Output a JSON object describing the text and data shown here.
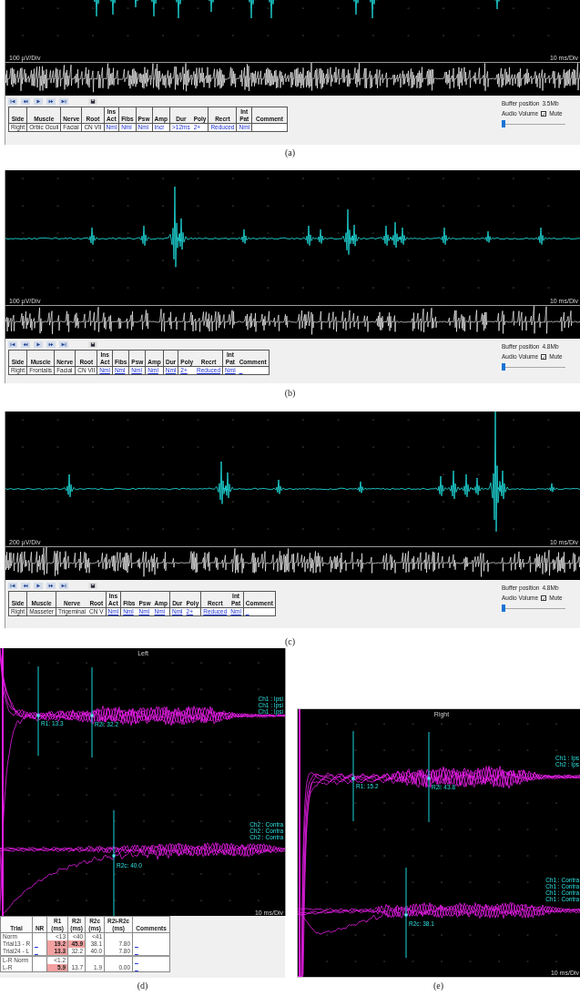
{
  "emg_panels": [
    {
      "amplitude_scale": "100 µV/Div",
      "time_scale": "10 ms/Div",
      "table": {
        "underline_links": false,
        "groups": [
          {
            "columns": [
              {
                "header": "Side",
                "value": "Right",
                "kind": "text"
              }
            ]
          },
          {
            "columns": [
              {
                "header": "Muscle",
                "value": "Orbic Oculi",
                "kind": "text"
              }
            ]
          },
          {
            "columns": [
              {
                "header": "Nerve",
                "value": "Facial",
                "kind": "text"
              }
            ]
          },
          {
            "columns": [
              {
                "header": "Root",
                "value": "CN VII",
                "kind": "text"
              }
            ]
          },
          {
            "columns": [
              {
                "header": "Ins Act",
                "value": "Nml",
                "kind": "link"
              }
            ]
          },
          {
            "columns": [
              {
                "header": "Fibs",
                "value": "Nml",
                "kind": "link"
              }
            ]
          },
          {
            "columns": [
              {
                "header": "Psw",
                "value": "Nml",
                "kind": "link"
              }
            ]
          },
          {
            "columns": [
              {
                "header": "Amp",
                "value": "Incr",
                "kind": "link"
              }
            ]
          },
          {
            "columns": [
              {
                "header": "Dur",
                "value": ">12ms",
                "kind": "link"
              },
              {
                "header": "Poly",
                "value": "2+",
                "kind": "link"
              }
            ]
          },
          {
            "columns": [
              {
                "header": "Recrt",
                "value": "Reduced",
                "kind": "link"
              }
            ]
          },
          {
            "columns": [
              {
                "header": "Int Pat",
                "value": "Nml",
                "kind": "link"
              }
            ]
          },
          {
            "columns": [
              {
                "header": "Comment",
                "kind": "link"
              }
            ]
          }
        ]
      },
      "buffer": {
        "label": "Buffer position",
        "value": "3.5Mb"
      },
      "audio": {
        "label": "Audio Volume",
        "mute": {
          "label": "Mute",
          "checked": true
        },
        "level": 0
      },
      "caption": "(a)"
    },
    {
      "amplitude_scale": "100 µV/Div",
      "time_scale": "10 ms/Div",
      "table": {
        "underline_links": true,
        "groups": [
          {
            "columns": [
              {
                "header": "Side",
                "value": "Right",
                "kind": "text"
              }
            ]
          },
          {
            "columns": [
              {
                "header": "Muscle",
                "value": "Frontalis",
                "kind": "text"
              }
            ]
          },
          {
            "columns": [
              {
                "header": "Nerve",
                "value": "Facial",
                "kind": "text"
              }
            ]
          },
          {
            "columns": [
              {
                "header": "Root",
                "value": "CN VII",
                "kind": "text"
              }
            ]
          },
          {
            "columns": [
              {
                "header": "Ins Act",
                "value": "Nml",
                "kind": "link"
              }
            ]
          },
          {
            "columns": [
              {
                "header": "Fibs",
                "value": "Nml",
                "kind": "link"
              }
            ]
          },
          {
            "columns": [
              {
                "header": "Psw",
                "value": "Nml",
                "kind": "link"
              }
            ]
          },
          {
            "columns": [
              {
                "header": "Amp",
                "value": "Nml",
                "kind": "link"
              }
            ]
          },
          {
            "columns": [
              {
                "header": "Dur",
                "value": "Nml",
                "kind": "link"
              }
            ]
          },
          {
            "columns": [
              {
                "header": "Poly",
                "value": "2+",
                "kind": "link"
              },
              {
                "header": "Recrt",
                "value": "Reduced",
                "kind": "link"
              }
            ]
          },
          {
            "columns": [
              {
                "header": "Int Pat",
                "value": "Nml",
                "kind": "link"
              },
              {
                "header": "Comment",
                "value": "_",
                "kind": "link"
              }
            ]
          }
        ]
      },
      "buffer": {
        "label": "Buffer position",
        "value": "4.8Mb"
      },
      "audio": {
        "label": "Audio Volume",
        "mute": {
          "label": "Mute",
          "checked": true
        },
        "level": 0
      },
      "caption": "(b)"
    },
    {
      "amplitude_scale": "200 µV/Div",
      "time_scale": "10 ms/Div",
      "table": {
        "underline_links": true,
        "groups": [
          {
            "columns": [
              {
                "header": "Side",
                "value": "Right",
                "kind": "text"
              }
            ]
          },
          {
            "columns": [
              {
                "header": "Muscle",
                "value": "Masseter",
                "kind": "text"
              }
            ]
          },
          {
            "columns": [
              {
                "header": "Nerve",
                "value": "Trigeminal",
                "kind": "text"
              },
              {
                "header": "Root",
                "value": "CN V",
                "kind": "text"
              }
            ]
          },
          {
            "columns": [
              {
                "header": "Ins Act",
                "value": "Nml",
                "kind": "link"
              }
            ]
          },
          {
            "columns": [
              {
                "header": "Fibs",
                "value": "Nml",
                "kind": "link"
              },
              {
                "header": "Psw",
                "value": "Nml",
                "kind": "link"
              },
              {
                "header": "Amp",
                "value": "Nml",
                "kind": "link"
              }
            ]
          },
          {
            "columns": [
              {
                "header": "Dur",
                "value": "Nml",
                "kind": "link"
              },
              {
                "header": "Poly",
                "value": "2+",
                "kind": "link"
              }
            ]
          },
          {
            "columns": [
              {
                "header": "Recrt",
                "value": "Reduced",
                "kind": "link"
              },
              {
                "header": "Int Pat",
                "value": "Nml",
                "kind": "link"
              }
            ]
          },
          {
            "columns": [
              {
                "header": "Comment",
                "value": "_",
                "kind": "link"
              }
            ]
          }
        ]
      },
      "buffer": {
        "label": "Buffer position",
        "value": "4.8Mb"
      },
      "audio": {
        "label": "Audio Volume",
        "mute": {
          "label": "Mute",
          "checked": true
        },
        "level": 0
      },
      "caption": "(c)"
    }
  ],
  "reflex_panels": [
    {
      "title": "Left",
      "cursors": [
        "R1: 13.3",
        "R2i: 32.2",
        "R2c: 40.0"
      ],
      "upper_channel_labels": [
        "Ch1 : Ipsi",
        "Ch1 : Ipsi",
        "Ch1 : Ipsi"
      ],
      "lower_channel_labels": [
        "Ch2 : Contra",
        "Ch2 : Contra",
        "Ch2 : Contra"
      ],
      "time_scale": "10 ms/Div",
      "table": {
        "columns": [
          {
            "label": "Trial",
            "kind": "text"
          },
          {
            "label": "NR",
            "kind": "link"
          },
          {
            "label": "R1 (ms)",
            "kind": "text"
          },
          {
            "label": "R2i (ms)",
            "kind": "text"
          },
          {
            "label": "R2c (ms)",
            "kind": "text"
          },
          {
            "label": "R2i-R2c (ms)",
            "kind": "text"
          },
          {
            "label": "Comments",
            "kind": "link"
          }
        ],
        "rows": [
          {
            "separator_above": false,
            "cells": [
              {
                "text": "Norm",
                "abnormal": false
              },
              {
                "abnormal": false
              },
              {
                "text": "<13",
                "abnormal": false
              },
              {
                "text": "<40",
                "abnormal": false
              },
              {
                "text": "<41",
                "abnormal": false
              },
              {
                "abnormal": false
              },
              {
                "abnormal": false
              }
            ]
          },
          {
            "separator_above": false,
            "cells": [
              {
                "text": "Trial13 - R",
                "abnormal": false
              },
              {
                "text": "_",
                "abnormal": false
              },
              {
                "text": "19.2",
                "abnormal": true
              },
              {
                "text": "45.9",
                "abnormal": true
              },
              {
                "text": "38.1",
                "abnormal": false
              },
              {
                "text": "7.80",
                "abnormal": false
              },
              {
                "text": "_",
                "abnormal": false
              }
            ]
          },
          {
            "separator_above": false,
            "cells": [
              {
                "text": "Trial24 - L",
                "abnormal": false
              },
              {
                "text": "_",
                "abnormal": false
              },
              {
                "text": "13.3",
                "abnormal": true
              },
              {
                "text": "32.2",
                "abnormal": false
              },
              {
                "text": "40.0",
                "abnormal": false
              },
              {
                "text": "7.80",
                "abnormal": false
              },
              {
                "text": "_",
                "abnormal": false
              }
            ]
          },
          {
            "separator_above": true,
            "cells": [
              {
                "text": "L-R Norm",
                "abnormal": false
              },
              {
                "abnormal": false
              },
              {
                "text": "<1.2",
                "abnormal": false
              },
              {
                "abnormal": false
              },
              {
                "abnormal": false
              },
              {
                "abnormal": false
              },
              {
                "text": "_",
                "abnormal": false
              }
            ]
          },
          {
            "separator_above": false,
            "cells": [
              {
                "text": "L-R",
                "abnormal": false
              },
              {
                "abnormal": false
              },
              {
                "text": "5.9",
                "abnormal": true
              },
              {
                "text": "13.7",
                "abnormal": false
              },
              {
                "text": "1.9",
                "abnormal": false
              },
              {
                "text": "0.00",
                "abnormal": false
              },
              {
                "text": "_",
                "abnormal": false
              }
            ]
          }
        ]
      },
      "caption": "(d)"
    },
    {
      "title": "Right",
      "cursors": [
        "R1: 15.2",
        "R2i: 43.8",
        "R2c: 38.1"
      ],
      "upper_channel_labels": [
        "Ch1 : Ips",
        "Ch2 : Ips"
      ],
      "lower_channel_labels": [
        "Ch1 : Contra",
        "Ch1 : Contra",
        "Ch1 : Contra",
        "Ch1 : Contra"
      ],
      "time_scale": "10 ms/Div",
      "caption": "(e)"
    }
  ]
}
